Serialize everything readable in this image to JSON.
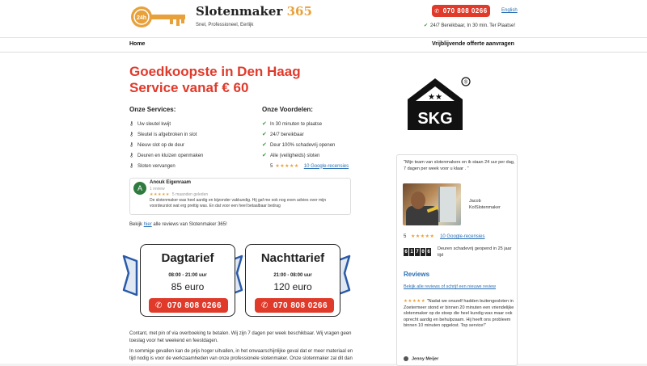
{
  "header": {
    "brand_name": "Slotenmaker",
    "brand_number": "365",
    "logo_badge": "24h",
    "tagline": "Snel, Professioneel, Eerlijk",
    "phone": "070 808 0266",
    "language_link": "English",
    "availability": "24/7 Bereikbaar, In 30 min. Ter Plaatse!"
  },
  "nav": {
    "home": "Home",
    "quote": "Vrijblijvende offerte aanvragen"
  },
  "hero": {
    "title_line1": "Goedkoopste in Den Haag",
    "title_line2": "Service vanaf € 60"
  },
  "services": {
    "heading": "Onze Services:",
    "items": [
      "Uw sleutel kwijt",
      "Sleutel is afgebroken in slot",
      "Nieuw slot op de deur",
      "Deuren en kluizen openmaken",
      "Sloten vervangen"
    ]
  },
  "advantages": {
    "heading": "Onze Voordelen:",
    "items": [
      "In 30 minuten te plaatse",
      "24/7 bereikbaar",
      "Deur 100% schadevrij openen",
      "Alle (veiligheids) sloten"
    ],
    "rating": "5",
    "stars": "★★★★★",
    "reviews_link": "10 Google-recensies"
  },
  "review": {
    "avatar_letter": "A",
    "name": "Anouk Eigenraam",
    "count": "1 review",
    "stars": "★★★★★",
    "time": "5 maanden geleden",
    "text": "De slotenmaker was heel aardig en bijzonder vakkundig. Hij gaf me ook nog even advies over mijn voordeurslot wat erg prettig was.  En dat voor een heel betaalbaar bedrag"
  },
  "all_reviews": {
    "prefix": "Bekijk",
    "link": "hier",
    "suffix": "alle reviews van Slotenmaker 365!"
  },
  "tariffs": [
    {
      "name": "Dagtarief",
      "hours": "08:00 - 21:00 uur",
      "price": "85 euro",
      "phone": "070 808 0266"
    },
    {
      "name": "Nachttarief",
      "hours": "21:00 - 08:00 uur",
      "price": "120 euro",
      "phone": "070 808 0266"
    }
  ],
  "paragraphs": {
    "p1": "Contant, met pin of via overboeking te betalen. Wij zijn 7 dagen per week beschikbaar. Wij vragen geen toeslag voor het weekend en feestdagen.",
    "p2": "In sommige gevallen kan de prijs hoger uitvallen, in het onwaarschijnlijke geval dat er meer materiaal en tijd nodig is voor de werkzaamheden van onze professionele slotenmaker. Onze slotenmaker zal dit dan"
  },
  "skg": {
    "label": "SKG",
    "registered": "®",
    "stars": "★★"
  },
  "sidebar": {
    "quote": "\"Mijn team van slotenmakers en ik staan 24 uur per dag, 7 dagen per week voor u klaar . \"",
    "person_name": "Jacob",
    "person_title": "KolSlotenmaker",
    "rating": "5",
    "stars": "★★★★★",
    "reviews_link": "10 Google-recensies",
    "counter_digits": [
      "6",
      "1",
      "7",
      "0",
      "6"
    ],
    "counter_text": "Deuren schadevrij geopend in 25 jaar tijd",
    "reviews_heading": "Reviews",
    "reviews_link2": "Bekijk alle reviews of schrijf een nieuwe review",
    "review_stars": "★★★★★",
    "review_text": "\"Nadat we onszelf hadden buitengesloten in Zoetermeer stond er binnen 20 minuten een vriendelijke slotenmaker op de stoep die heel kundig was maar ook oprecht aardig en behulpzaam. Hij heeft ons probleem binnen 10 minuten opgelost. Top service!\"",
    "review_author": "Jenny Meijer"
  },
  "colors": {
    "accent_red": "#e03a2b",
    "brand_orange": "#e8a13a",
    "link_blue": "#2a6fb3"
  }
}
